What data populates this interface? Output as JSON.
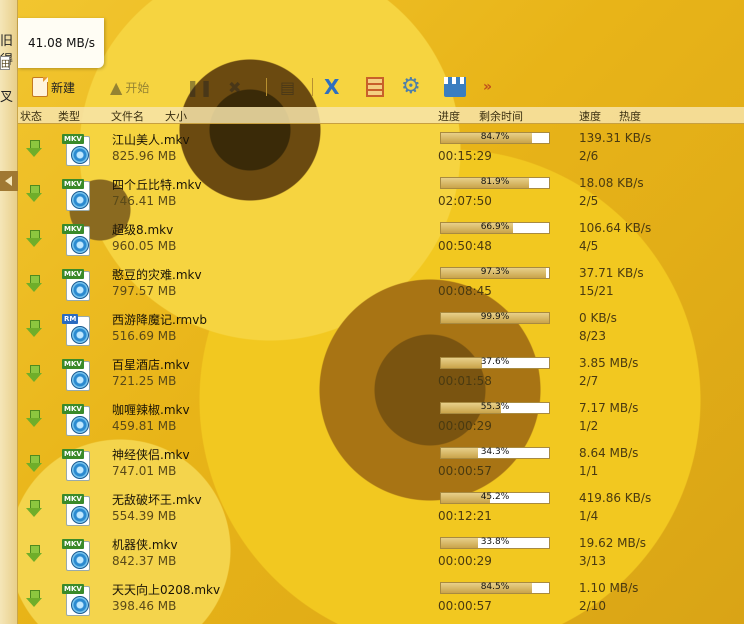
{
  "left_panel": {
    "chars": [
      "旧得",
      "田",
      "叉"
    ],
    "box_label": "田"
  },
  "speed_tooltip": "41.08 MB/s",
  "toolbar": {
    "new_label": "新建",
    "open_label": "开始",
    "pause_label": "暂停",
    "more_symbol": "»"
  },
  "columns": {
    "status": "状态",
    "type": "类型",
    "filename": "文件名",
    "size": "大小",
    "progress": "进度",
    "remaining": "剩余时间",
    "speed": "速度",
    "heat": "热度"
  },
  "downloads": [
    {
      "name": "江山美人.mkv",
      "size": "825.96 MB",
      "progress": 84.7,
      "progress_label": "84.7%",
      "remaining": "00:15:29",
      "speed": "139.31 KB/s",
      "heat": "2/6",
      "type": "MKV"
    },
    {
      "name": "四个丘比特.mkv",
      "size": "746.41 MB",
      "progress": 81.9,
      "progress_label": "81.9%",
      "remaining": "02:07:50",
      "speed": "18.08 KB/s",
      "heat": "2/5",
      "type": "MKV"
    },
    {
      "name": "超级8.mkv",
      "size": "960.05 MB",
      "progress": 66.9,
      "progress_label": "66.9%",
      "remaining": "00:50:48",
      "speed": "106.64 KB/s",
      "heat": "4/5",
      "type": "MKV"
    },
    {
      "name": "憨豆的灾难.mkv",
      "size": "797.57 MB",
      "progress": 97.3,
      "progress_label": "97.3%",
      "remaining": "00:08:45",
      "speed": "37.71 KB/s",
      "heat": "15/21",
      "type": "MKV"
    },
    {
      "name": "西游降魔记.rmvb",
      "size": "516.69 MB",
      "progress": 99.9,
      "progress_label": "99.9%",
      "remaining": "",
      "speed": "0 KB/s",
      "heat": "8/23",
      "type": "RM"
    },
    {
      "name": "百星酒店.mkv",
      "size": "721.25 MB",
      "progress": 37.6,
      "progress_label": "37.6%",
      "remaining": "00:01:58",
      "speed": "3.85 MB/s",
      "heat": "2/7",
      "type": "MKV"
    },
    {
      "name": "咖喱辣椒.mkv",
      "size": "459.81 MB",
      "progress": 55.3,
      "progress_label": "55.3%",
      "remaining": "00:00:29",
      "speed": "7.17 MB/s",
      "heat": "1/2",
      "type": "MKV"
    },
    {
      "name": "神经侠侣.mkv",
      "size": "747.01 MB",
      "progress": 34.3,
      "progress_label": "34.3%",
      "remaining": "00:00:57",
      "speed": "8.64 MB/s",
      "heat": "1/1",
      "type": "MKV"
    },
    {
      "name": "无敌破坏王.mkv",
      "size": "554.39 MB",
      "progress": 45.2,
      "progress_label": "45.2%",
      "remaining": "00:12:21",
      "speed": "419.86 KB/s",
      "heat": "1/4",
      "type": "MKV"
    },
    {
      "name": "机器侠.mkv",
      "size": "842.37 MB",
      "progress": 33.8,
      "progress_label": "33.8%",
      "remaining": "00:00:29",
      "speed": "19.62 MB/s",
      "heat": "3/13",
      "type": "MKV"
    },
    {
      "name": "天天向上0208.mkv",
      "size": "398.46 MB",
      "progress": 84.5,
      "progress_label": "84.5%",
      "remaining": "00:00:57",
      "speed": "1.10 MB/s",
      "heat": "2/10",
      "type": "MKV"
    }
  ],
  "colors": {
    "progress_fill": "#c9a44a",
    "status_arrow": "#6fae2a",
    "background": "#e4b11c"
  }
}
